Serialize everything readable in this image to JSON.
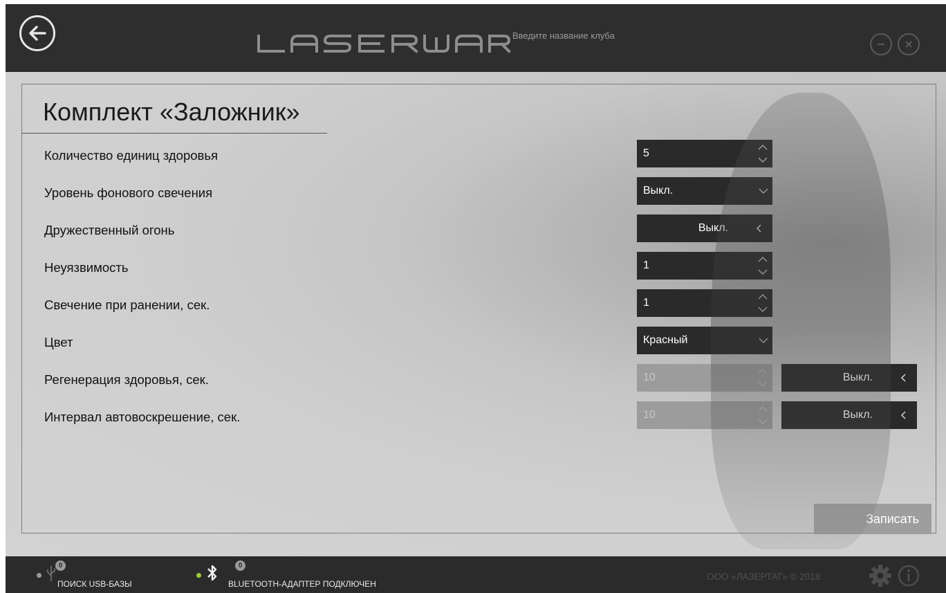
{
  "header": {
    "logo_text": "LASERWAR",
    "club_placeholder": "Введите название клуба",
    "back_icon": "arrow-left-icon",
    "minimize_icon": "minus-circle-icon",
    "close_icon": "x-circle-icon"
  },
  "panel": {
    "title": "Комплект «Заложник»",
    "rows": [
      {
        "label": "Количество единиц здоровья",
        "value": "5",
        "control": "spinner"
      },
      {
        "label": "Уровень фонового свечения",
        "value": "Выкл.",
        "control": "dropdown"
      },
      {
        "label": "Дружественный огонь",
        "value": "Выкл.",
        "control": "toggle"
      },
      {
        "label": "Неуязвимость",
        "value": "1",
        "control": "spinner"
      },
      {
        "label": "Свечение при ранении, сек.",
        "value": "1",
        "control": "spinner"
      },
      {
        "label": "Цвет",
        "value": "Красный",
        "control": "dropdown"
      },
      {
        "label": "Регенерация здоровья, сек.",
        "value": "10",
        "control": "spinner-disabled",
        "toggle_value": "Выкл."
      },
      {
        "label": "Интервал автовоскрешение, сек.",
        "value": "10",
        "control": "spinner-disabled",
        "toggle_value": "Выкл."
      }
    ],
    "save_label": "Записать"
  },
  "footer": {
    "usb": {
      "label": "ПОИСК USB-БАЗЫ",
      "count": "0",
      "status_color": "#9a9a9a",
      "icon": "usb-icon"
    },
    "bluetooth": {
      "label": "BLUETOOTH-АДАПТЕР ПОДКЛЮЧЕН",
      "count": "0",
      "status_color": "#9ccc3c",
      "icon": "bluetooth-icon"
    },
    "copyright": "ООО «ЛАЗЕРТАГ» © 2018",
    "settings_icon": "gear-icon",
    "info_icon": "info-icon"
  }
}
